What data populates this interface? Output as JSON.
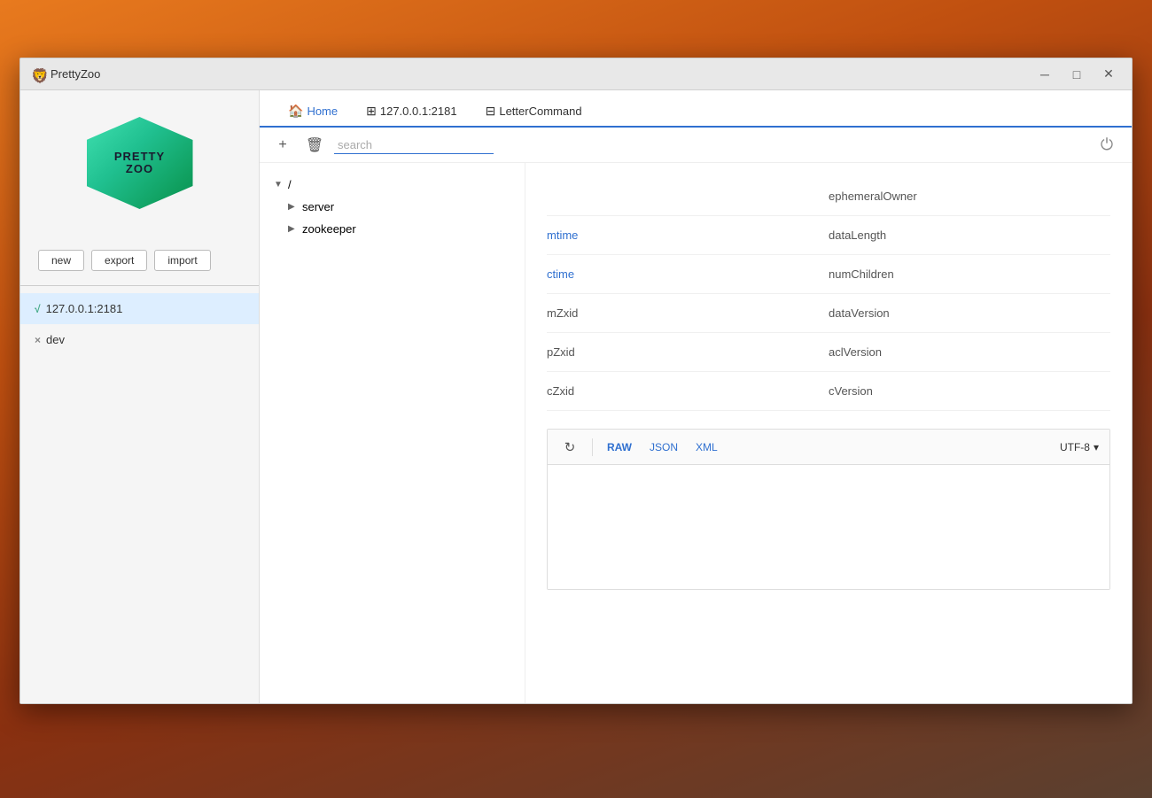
{
  "desktop": {
    "bg_note": "orange mountain background"
  },
  "window": {
    "title": "PrettyZoo",
    "title_icon": "🦁"
  },
  "titlebar": {
    "title": "PrettyZoo",
    "minimize_label": "─",
    "maximize_label": "□",
    "close_label": "✕"
  },
  "sidebar": {
    "logo_text_line1": "PRETTYZOO",
    "actions": {
      "new_label": "new",
      "export_label": "export",
      "import_label": "import"
    },
    "servers": [
      {
        "prefix": "√",
        "prefix_class": "active",
        "name": "127.0.0.1:2181",
        "active": true
      },
      {
        "prefix": "×",
        "prefix_class": "offline",
        "name": "dev",
        "active": false
      }
    ]
  },
  "breadcrumb": {
    "items": [
      {
        "icon": "🏠",
        "label": "Home",
        "active": true
      },
      {
        "icon": "⊞",
        "label": "127.0.0.1:2181",
        "active": false
      },
      {
        "icon": "⊟",
        "label": "LetterCommand",
        "active": false
      }
    ]
  },
  "toolbar": {
    "add_label": "+",
    "delete_label": "🗑",
    "search_placeholder": "search",
    "power_label": "⏻"
  },
  "tree": {
    "root": "/",
    "nodes": [
      {
        "label": "server",
        "level": "child",
        "arrow": "▶"
      },
      {
        "label": "zookeeper",
        "level": "child",
        "arrow": "▶"
      }
    ],
    "root_arrow": "▼"
  },
  "detail": {
    "fields": [
      {
        "label": "ephemeralOwner",
        "col": 1,
        "blue": false
      },
      {
        "label": "mtime",
        "col": 0,
        "blue": true
      },
      {
        "label": "dataLength",
        "col": 1,
        "blue": false
      },
      {
        "label": "ctime",
        "col": 0,
        "blue": true
      },
      {
        "label": "numChildren",
        "col": 1,
        "blue": false
      },
      {
        "label": "mZxid",
        "col": 0,
        "blue": false
      },
      {
        "label": "dataVersion",
        "col": 1,
        "blue": false
      },
      {
        "label": "pZxid",
        "col": 0,
        "blue": false
      },
      {
        "label": "aclVersion",
        "col": 1,
        "blue": false
      },
      {
        "label": "cZxid",
        "col": 0,
        "blue": false
      },
      {
        "label": "cVersion",
        "col": 1,
        "blue": false
      }
    ]
  },
  "editor": {
    "refresh_label": "↻",
    "formats": [
      "RAW",
      "JSON",
      "XML"
    ],
    "active_format": "RAW",
    "encoding": "UTF-8",
    "content": ""
  }
}
